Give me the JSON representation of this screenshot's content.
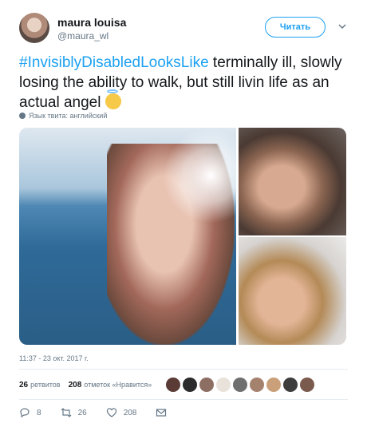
{
  "author": {
    "name": "maura louisa",
    "handle": "@maura_wl"
  },
  "follow_label": "Читать",
  "tweet": {
    "hashtag": "#InvisiblyDisabledLooksLike",
    "text": " terminally ill, slowly losing the ability to walk, but still livin life as an actual angel "
  },
  "language_note": "Язык твита: английский",
  "timestamp": "11:37 - 23 окт. 2017 г.",
  "stats": {
    "retweets_count": "26",
    "retweets_label": "ретвитов",
    "likes_count": "208",
    "likes_label": "отметок «Нравится»"
  },
  "actions": {
    "replies": "8",
    "retweets": "26",
    "likes": "208"
  },
  "liker_colors": [
    "#5a3b36",
    "#2b2b2b",
    "#8d6e63",
    "#e8e2da",
    "#6f6f6f",
    "#a5826d",
    "#c9a07a",
    "#3d3d3d",
    "#7b5a4e"
  ],
  "colors": {
    "accent": "#1da1f2",
    "muted": "#657786",
    "text": "#14171a"
  }
}
